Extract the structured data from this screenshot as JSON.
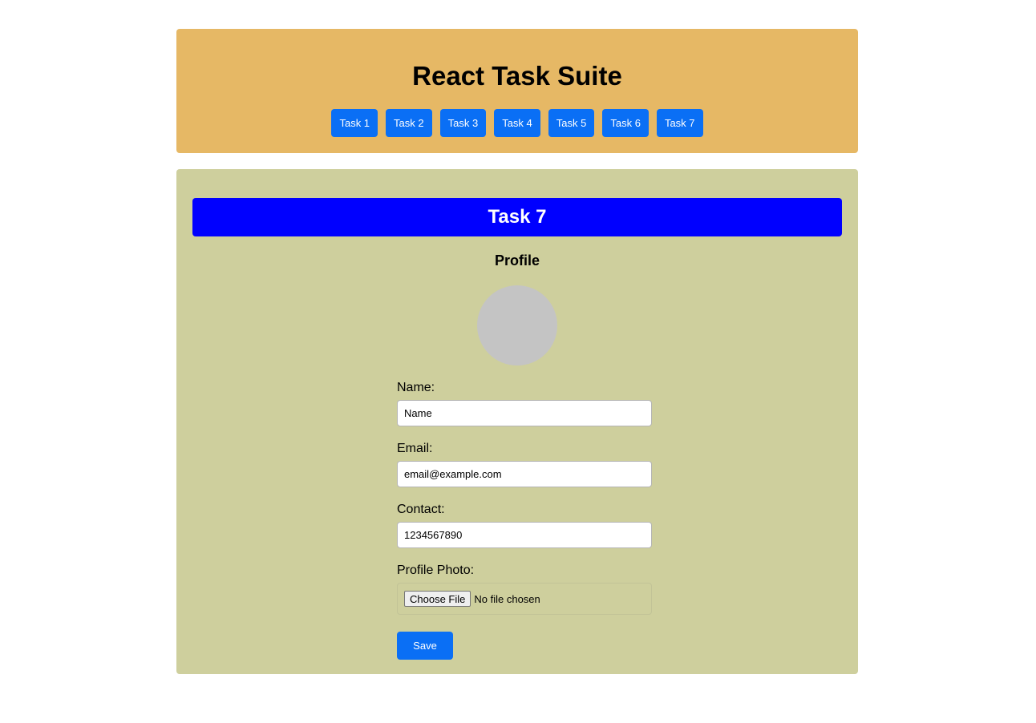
{
  "header": {
    "title": "React Task Suite",
    "tabs": [
      {
        "label": "Task 1"
      },
      {
        "label": "Task 2"
      },
      {
        "label": "Task 3"
      },
      {
        "label": "Task 4"
      },
      {
        "label": "Task 5"
      },
      {
        "label": "Task 6"
      },
      {
        "label": "Task 7"
      }
    ]
  },
  "panel": {
    "banner_title": "Task 7",
    "section_heading": "Profile",
    "avatar_icon": "avatar-placeholder-icon",
    "fields": {
      "name": {
        "label": "Name:",
        "value": "Name"
      },
      "email": {
        "label": "Email:",
        "value": "email@example.com"
      },
      "contact": {
        "label": "Contact:",
        "value": "1234567890"
      },
      "photo": {
        "label": "Profile Photo:",
        "button_label": "Choose File",
        "status": "No file chosen"
      }
    },
    "save_label": "Save"
  },
  "colors": {
    "header_bg": "#e6b865",
    "panel_bg": "#cecf9d",
    "banner_bg": "#0000ff",
    "button_bg": "#0a6ff5",
    "avatar_bg": "#c4c4c4"
  }
}
